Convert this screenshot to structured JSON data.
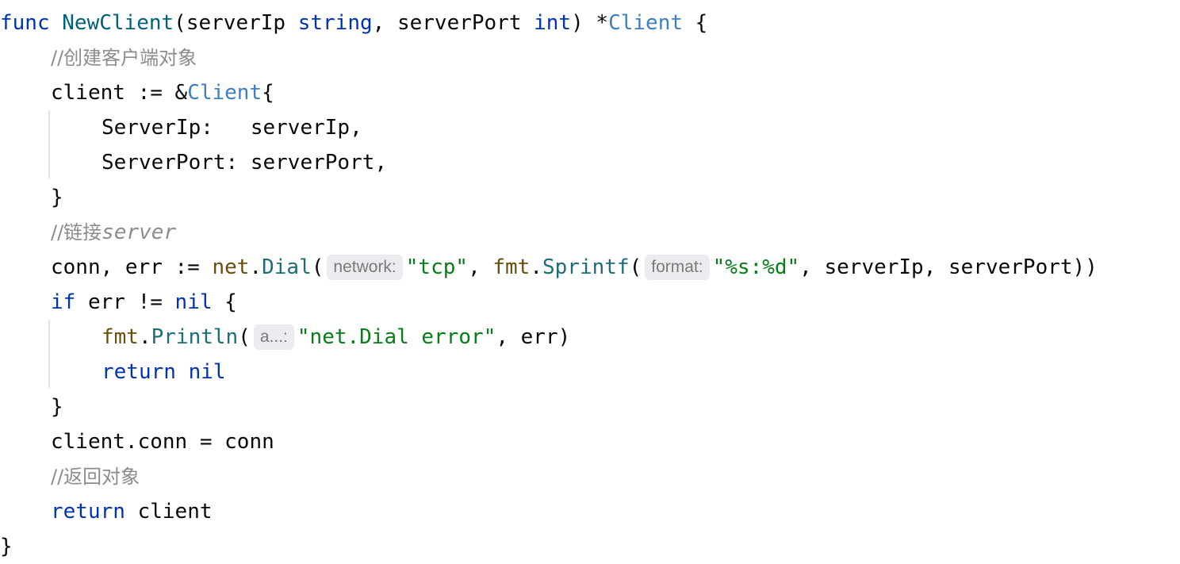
{
  "code": {
    "l1": {
      "kw_func": "func",
      "fn_name": "NewClient",
      "open_paren": "(",
      "p1_name": "serverIp",
      "p1_type": "string",
      "sep": ", ",
      "p2_name": "serverPort",
      "p2_type": "int",
      "close_paren": ") *",
      "ret_type": "Client",
      "brace": " {"
    },
    "l2": {
      "comment": "//创建客户端对象"
    },
    "l3": {
      "lhs": "client := &",
      "type": "Client",
      "brace": "{"
    },
    "l4": {
      "text": "ServerIp:   serverIp,"
    },
    "l5": {
      "text": "ServerPort: serverPort,"
    },
    "l6": {
      "text": "}"
    },
    "l7": {
      "comment_prefix": "//链接",
      "comment_word": "server"
    },
    "l8": {
      "lhs": "conn, err := ",
      "pkg1": "net",
      "dot1": ".",
      "meth1": "Dial",
      "paren1": "(",
      "hint1": "network:",
      "str1": "\"tcp\"",
      "sep1": ", ",
      "pkg2": "fmt",
      "dot2": ".",
      "meth2": "Sprintf",
      "paren2": "(",
      "hint2": "format:",
      "str2": "\"%s:%d\"",
      "rest": ", serverIp, serverPort))"
    },
    "l9": {
      "kw_if": "if",
      "cond": " err != ",
      "kw_nil": "nil",
      "brace": " {"
    },
    "l10": {
      "pkg": "fmt",
      "dot": ".",
      "meth": "Println",
      "paren": "(",
      "hint": "a...:",
      "str": "\"net.Dial error\"",
      "rest": ", err)"
    },
    "l11": {
      "kw_return": "return",
      "kw_nil": " nil"
    },
    "l12": {
      "text": "}"
    },
    "l13": {
      "text": "client.conn = conn"
    },
    "l14": {
      "comment": "//返回对象"
    },
    "l15": {
      "kw_return": "return",
      "rest": " client"
    },
    "l16": {
      "text": "}"
    }
  },
  "colors": {
    "keyword": "#0033b3",
    "function_name": "#00627a",
    "type_ref": "#3e7ec4",
    "string": "#067d17",
    "package": "#6a4c0c",
    "method": "#1d6c76",
    "comment": "#8c8c8c",
    "hint_bg": "#ebecf0"
  }
}
